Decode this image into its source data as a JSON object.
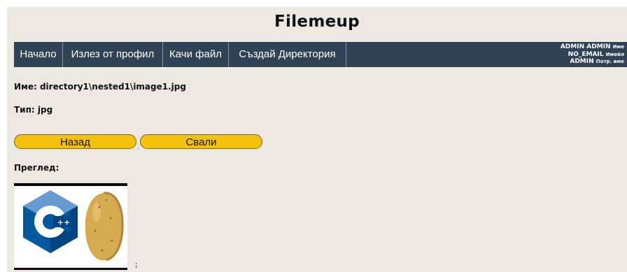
{
  "site": {
    "title": "Filemeup"
  },
  "nav": {
    "home": "Начало",
    "logout": "Излез от профил",
    "upload": "Качи файл",
    "create_dir": "Създай Директория"
  },
  "user": {
    "name": "ADMIN ADMIN",
    "name_label": "Име",
    "email": "NO_EMAIL",
    "email_label": "Имейл",
    "username": "ADMIN",
    "username_label": "Потр. име"
  },
  "file": {
    "name_line": "Име: directory1\\nested1\\image1.jpg",
    "type_line": "Тип: jpg"
  },
  "buttons": {
    "back": "Назад",
    "download": "Свали",
    "separator": "."
  },
  "preview": {
    "label": "Преглед:",
    "trailing": ";",
    "icons": [
      "cpp-logo-icon",
      "potato-icon"
    ]
  },
  "colors": {
    "nav_background": "#2f4356",
    "page_background": "#ece7e1",
    "button_fill": "#f4c20b",
    "cpp_blue_light": "#659ad2",
    "cpp_blue_dark": "#004482",
    "potato": "#d6aa4e"
  }
}
